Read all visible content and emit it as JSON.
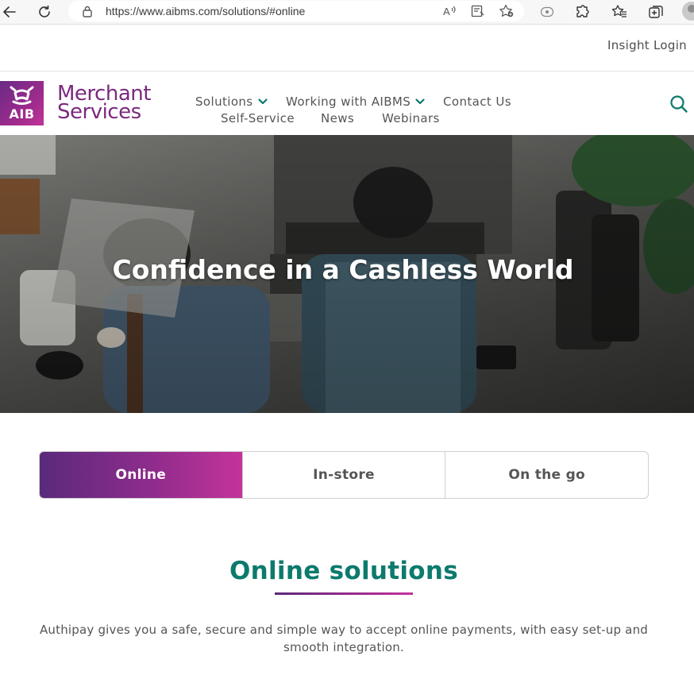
{
  "browser": {
    "url": "https://www.aibms.com/solutions/#online",
    "icons": [
      "back-arrow-icon",
      "reload-icon",
      "lock-icon",
      "read-aloud-icon",
      "immersive-reader-icon",
      "add-favorite-icon",
      "extension-icon",
      "puzzle-icon",
      "favorites-icon",
      "collections-icon",
      "profile-icon"
    ]
  },
  "utility": {
    "insight_login": "Insight Login"
  },
  "header": {
    "logo_badge": "AIB",
    "logo_line1": "Merchant",
    "logo_line2": "Services",
    "nav": {
      "solutions": "Solutions",
      "working": "Working with AIBMS",
      "contact": "Contact Us",
      "self_service": "Self-Service",
      "news": "News",
      "webinars": "Webinars"
    }
  },
  "hero": {
    "title": "Confidence in a Cashless World"
  },
  "tabs": {
    "online": "Online",
    "instore": "In-store",
    "onthego": "On the go",
    "active": "Online"
  },
  "section": {
    "title": "Online solutions",
    "body": "Authipay gives you a safe, secure and simple way to accept online payments, with easy set-up and smooth integration."
  },
  "colors": {
    "brand_purple": "#7a2a7e",
    "brand_teal": "#0c7a6d",
    "gradient_start": "#5a2a7a",
    "gradient_end": "#c4339a"
  }
}
